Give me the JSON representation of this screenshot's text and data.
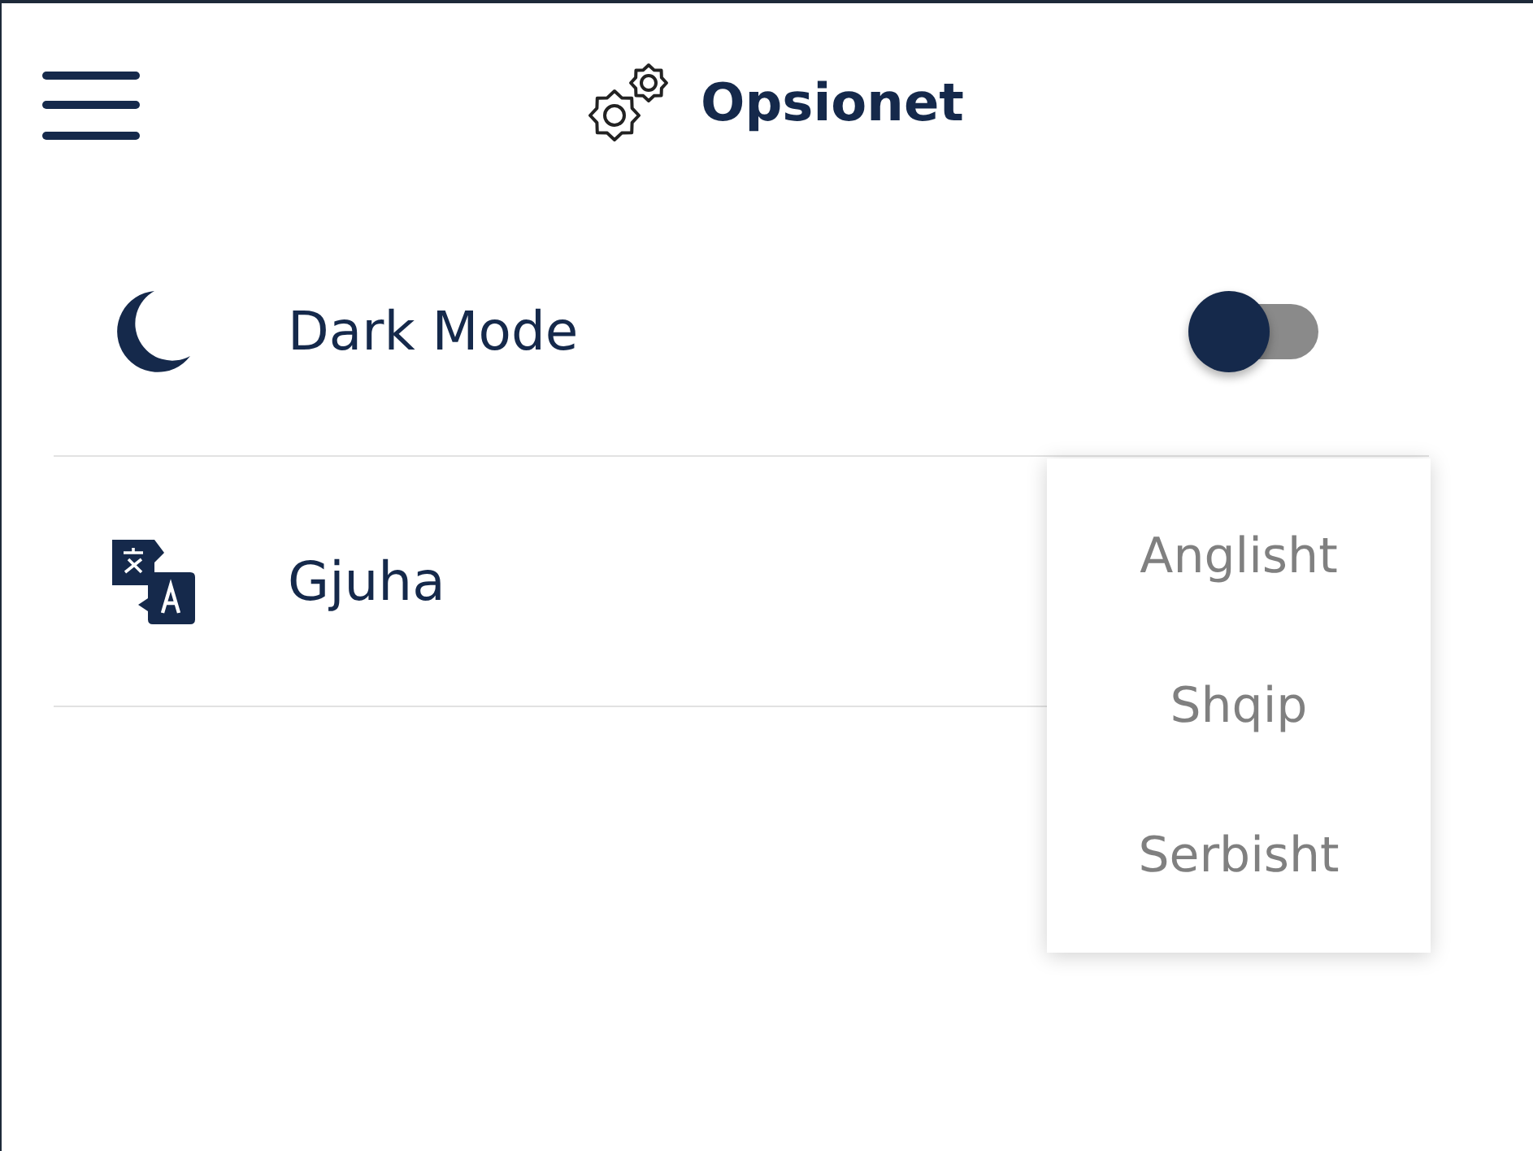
{
  "header": {
    "title": "Opsionet"
  },
  "settings": [
    {
      "kind": "toggle",
      "label": "Dark Mode",
      "on": false
    },
    {
      "kind": "select",
      "label": "Gjuha",
      "expanded": true,
      "options": [
        "Anglisht",
        "Shqip",
        "Serbisht"
      ]
    }
  ]
}
